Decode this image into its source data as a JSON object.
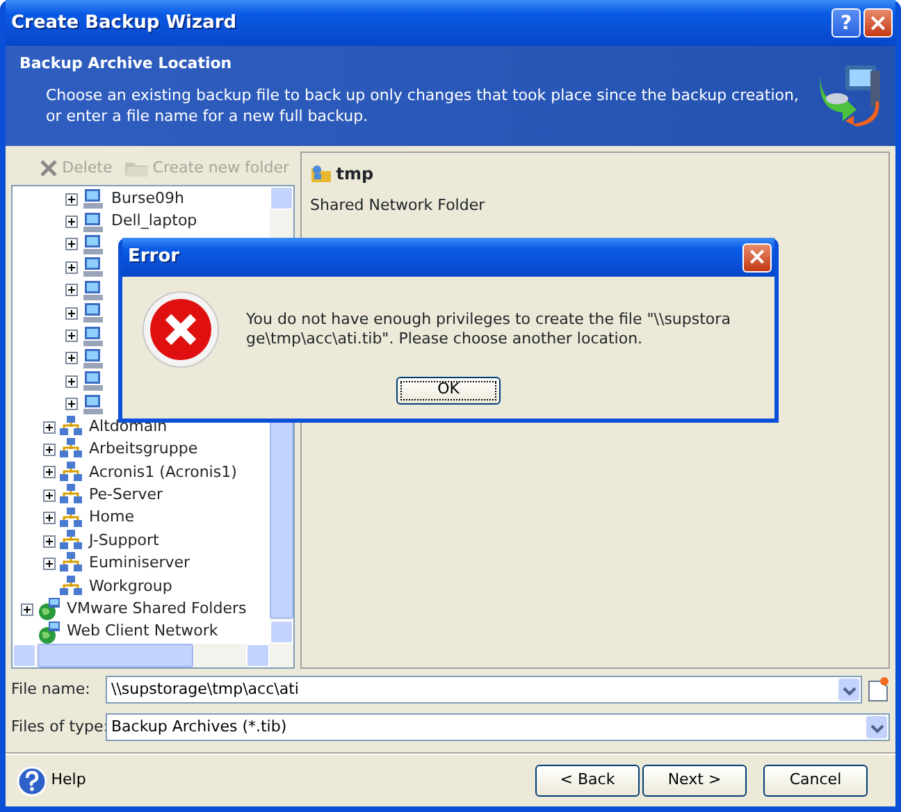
{
  "window": {
    "title": "Create Backup Wizard",
    "help_button": "?",
    "close_button": "×"
  },
  "header": {
    "title": "Backup Archive Location",
    "description": "Choose an existing backup file to back up only changes that took place since the backup creation, or enter a file name for a new full backup."
  },
  "toolbar": [
    {
      "label": "Delete",
      "disabled": true
    },
    {
      "label": "Create new folder",
      "disabled": true
    }
  ],
  "tree": {
    "items": [
      {
        "kind": "network",
        "children": [
          {
            "kind": "workgroup",
            "children": [
              {
                "kind": "computer",
                "label": "Burse09h",
                "expandable": true
              },
              {
                "kind": "computer",
                "label": "Dell_laptop",
                "expandable": true
              },
              {
                "kind": "computer",
                "expandable": true
              },
              {
                "kind": "computer",
                "expandable": true
              },
              {
                "kind": "computer",
                "expandable": true
              },
              {
                "kind": "computer",
                "expandable": true
              },
              {
                "kind": "computer",
                "expandable": true
              },
              {
                "kind": "computer",
                "expandable": true
              },
              {
                "kind": "computer",
                "expandable": true
              },
              {
                "kind": "computer",
                "expandable": true
              }
            ]
          },
          {
            "kind": "workgroup",
            "label": "Altdomain",
            "expandable": true
          },
          {
            "kind": "workgroup",
            "label": "Arbeitsgruppe",
            "expandable": true
          },
          {
            "kind": "workgroup",
            "label": "Acronis1 (Acronis1)",
            "expandable": true
          },
          {
            "kind": "workgroup",
            "label": "Pe-Server",
            "expandable": true
          },
          {
            "kind": "workgroup",
            "label": "Home",
            "expandable": true
          },
          {
            "kind": "workgroup",
            "label": "J-Support",
            "expandable": true
          },
          {
            "kind": "workgroup",
            "label": "Euminiserver",
            "expandable": true
          },
          {
            "kind": "workgroup",
            "label": "Workgroup",
            "expandable": false
          }
        ]
      },
      {
        "kind": "globe",
        "label": "VMware Shared Folders",
        "expandable": true
      },
      {
        "kind": "globe",
        "label": "Web Client Network",
        "expandable": false
      }
    ]
  },
  "details": {
    "name": "tmp",
    "type": "Shared Network Folder"
  },
  "file_name": {
    "label": "File name:",
    "value": "\\\\supstorage\\tmp\\acc\\ati"
  },
  "file_type": {
    "label": "Files of type:",
    "value": "Backup Archives (*.tib)"
  },
  "footer": {
    "help": "Help",
    "buttons": [
      "< Back",
      "Next >",
      "Cancel"
    ]
  },
  "error_dialog": {
    "title": "Error",
    "close_button": "×",
    "message": "You do not have enough privileges to create the file \"\\\\supstorage\\tmp\\acc\\ati.tib\". Please choose another location.",
    "button": "OK"
  }
}
